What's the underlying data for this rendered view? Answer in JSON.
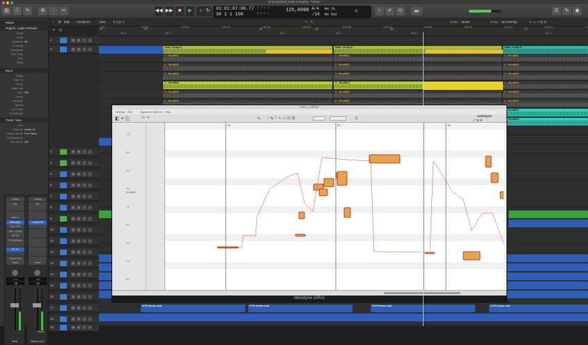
{
  "window": {
    "title": "ninoiosy2018_bake-comping - Tracks"
  },
  "transport": {
    "position_time": "01:01:07:06.77",
    "position_bars": "36  1  1  158",
    "tempo": "125,0000",
    "time_sig": "4/4",
    "division": "/16",
    "in_label": "No In",
    "out_label": "No Out",
    "beats_top": "2  1  1  1",
    "beats_bottom": "6  1  1  1"
  },
  "toolbar": {
    "edit": "Edit",
    "functions": "Functions",
    "view": "View",
    "snap_label": "Snap:",
    "snap_value": "Smart",
    "drag_label": "Drag:",
    "drag_value": "No Overlap"
  },
  "inspector": {
    "header1": "Movie",
    "region_header": "Region: Audio Defaults",
    "region_rows": [
      {
        "label": "Mute",
        "value": ""
      },
      {
        "label": "Loop",
        "value": ""
      },
      {
        "label": "Quantize",
        "value": "off"
      },
      {
        "label": "Q-Swing",
        "value": ""
      },
      {
        "label": "Transpose",
        "value": ""
      },
      {
        "label": "Fine Tune",
        "value": ""
      },
      {
        "label": "Flex",
        "value": ""
      },
      {
        "label": "Gain",
        "value": ""
      }
    ],
    "more_header": "More",
    "more_rows": [
      {
        "label": "Delay",
        "value": ""
      },
      {
        "label": "Fade In",
        "value": ""
      },
      {
        "label": "Curve",
        "value": ""
      },
      {
        "label": "Fade Out",
        "value": ""
      },
      {
        "label": "Type",
        "value": "Out"
      },
      {
        "label": "Curve",
        "value": ""
      },
      {
        "label": "Reverse",
        "value": ""
      },
      {
        "label": "Speed",
        "value": ""
      },
      {
        "label": "Q-Range",
        "value": ""
      },
      {
        "label": "Q-Strength",
        "value": ""
      }
    ],
    "track_header": "Track: Nina",
    "track_rows": [
      {
        "label": "Icon",
        "value": ""
      },
      {
        "label": "Channel",
        "value": "Audio 21"
      },
      {
        "label": "Freeze Mode",
        "value": "Pre Fader"
      },
      {
        "label": "Q-Reference",
        "value": ""
      },
      {
        "label": "Flex Mode",
        "value": "Off"
      }
    ],
    "strip_left": {
      "slots": [
        "Setting",
        "EQ",
        "",
        "",
        "Input 1",
        "Melodyne",
        "Red 2 Ex",
        "Red...Comp",
        "VC 24",
        "EPachRevrb",
        "",
        "RC 24",
        "",
        "Stereo Out",
        "Read"
      ],
      "pan": "-3.3",
      "level": "-28",
      "name": "Nina"
    },
    "strip_right": {
      "slots": [
        "Setting",
        "EQ",
        "",
        "",
        "",
        "Compa-Dn",
        "",
        "",
        "",
        "",
        "",
        "",
        "",
        "",
        "Read"
      ],
      "pan": "-Inf",
      "level": "-32",
      "name": "Stereo Out",
      "bnce": "Bnce"
    }
  },
  "ruler": {
    "bars": [
      "32",
      "33",
      "34",
      "35",
      "36",
      "37"
    ],
    "bar_subs": [
      "32 3",
      "33 3",
      "34 3",
      "35 3",
      "36 3",
      "37 3"
    ],
    "times": [
      "1:01",
      "1:01:01",
      "1:01:02",
      "1:01:03",
      "1:01:04",
      "1:01:05",
      "1:01:06",
      "1:01:07",
      "1:01:08",
      "1:01:09",
      "1:01:10",
      "1:01:11",
      "1:01:12"
    ]
  },
  "tracks": [
    {
      "num": "1",
      "type": "audio",
      "color": "#3a7bd5"
    },
    {
      "num": "2",
      "type": "audio",
      "color": "#3a7bd5"
    },
    {
      "num": "3",
      "type": "midi",
      "color": "#4caf50"
    },
    {
      "num": "4",
      "type": "midi",
      "color": "#4caf50"
    },
    {
      "num": "5",
      "type": "audio",
      "color": "#3a7bd5"
    },
    {
      "num": "6",
      "type": "audio",
      "color": "#3a7bd5"
    },
    {
      "num": "7",
      "type": "audio",
      "color": "#3a7bd5"
    },
    {
      "num": "8",
      "type": "audio",
      "color": "#3a7bd5"
    },
    {
      "num": "9",
      "type": "midi",
      "color": "#4caf50"
    },
    {
      "num": "10",
      "type": "audio",
      "color": "#3a7bd5"
    },
    {
      "num": "11",
      "type": "audio",
      "color": "#3a7bd5"
    },
    {
      "num": "12",
      "type": "audio",
      "color": "#3a7bd5"
    },
    {
      "num": "13",
      "type": "audio",
      "color": "#3a7bd5"
    },
    {
      "num": "14",
      "type": "audio",
      "color": "#3a7bd5"
    },
    {
      "num": "15",
      "type": "audio",
      "color": "#3a7bd5"
    },
    {
      "num": "16",
      "type": "audio",
      "color": "#3a7bd5"
    },
    {
      "num": "17",
      "type": "audio",
      "color": "#3a7bd5"
    },
    {
      "num": "18",
      "type": "audio",
      "color": "#3a7bd5"
    },
    {
      "num": "19",
      "type": "audio",
      "color": "#3a7bd5"
    }
  ],
  "comps": [
    {
      "label": "Nina: Comp A",
      "color": "#a8c23a"
    },
    {
      "label": "Nina: Comp A",
      "color": "#a8c23a"
    },
    {
      "label": "Nina: Comp A",
      "color": "#29b9a5"
    }
  ],
  "takes": [
    "1 - NinaB01",
    "2 - NinaB02",
    "3 - NinaB03",
    "4 - NinaB04",
    "5 - NinaB05",
    "6 - NinaB06",
    "7 - NinaB07",
    "8 - NinaB08"
  ],
  "bottom_regions": [
    "GTR theme dub",
    "GTR theme dub",
    "GTR theme dub",
    "GTR theme dub"
  ],
  "melodyne": {
    "title": "Nina_Untitled",
    "menu": [
      "Settings",
      "Edit",
      "Algorithm",
      "Options",
      "Help"
    ],
    "brand": "melodyne",
    "bars": [
      "33",
      "34",
      "35",
      "36"
    ],
    "pitch_labels": [
      "C5",
      "B4",
      "A4",
      "G4",
      "F4",
      "E4",
      "D4",
      "C4",
      "B3"
    ],
    "key_label": "A Maj/A",
    "footer": "Melodyne (ARA)"
  }
}
